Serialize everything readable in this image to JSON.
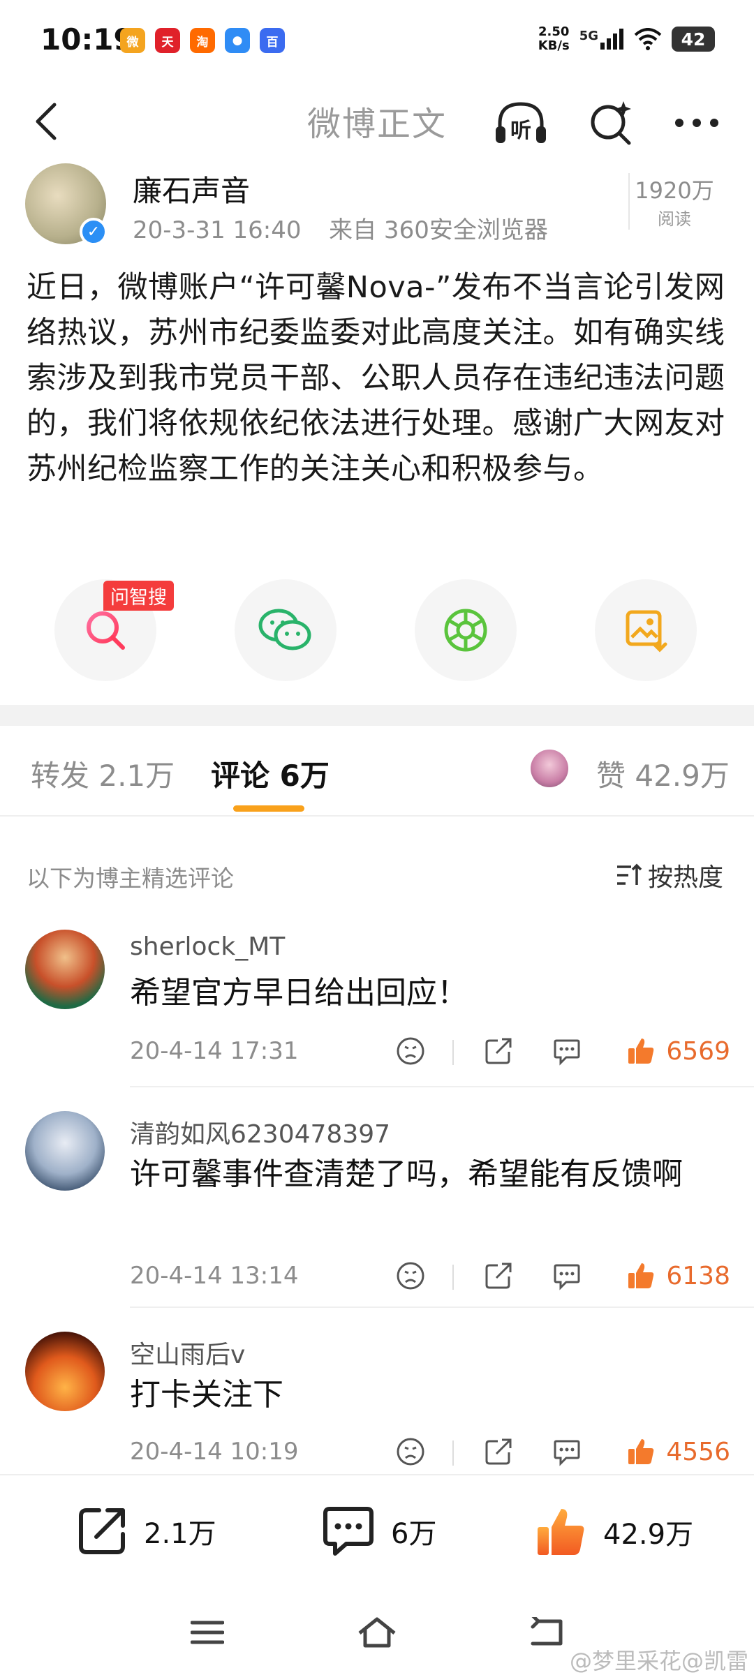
{
  "status_bar": {
    "time": "10:19",
    "apps": [
      {
        "icon": "weibo-icon",
        "color": "#f4a41f",
        "glyph": "微"
      },
      {
        "icon": "tmall-icon",
        "color": "#e0212a",
        "glyph": "天"
      },
      {
        "icon": "taobao-icon",
        "color": "#ff6a00",
        "glyph": "淘"
      },
      {
        "icon": "browser-icon",
        "color": "#2f8cf5",
        "glyph": "●"
      },
      {
        "icon": "baidu-icon",
        "color": "#3b6bf0",
        "glyph": "百"
      }
    ],
    "speed_value": "2.50",
    "speed_unit": "KB/s",
    "network": "5G",
    "battery": "42"
  },
  "title_bar": {
    "title": "微博正文",
    "icons": [
      "back-icon",
      "listen-icon",
      "ai-search-icon",
      "more-icon"
    ],
    "listen_glyph": "听"
  },
  "post": {
    "author": "廉石声音",
    "date": "20-3-31 16:40",
    "source": "来自 360安全浏览器",
    "read_count": "1920万",
    "read_label": "阅读",
    "body": "近日，微博账户“许可馨Nova-”发布不当言论引发网络热议，苏州市纪委监委对此高度关注。如有确实线索涉及到我市党员干部、公职人员存在违纪违法问题的，我们将依规依纪依法进行处理。感谢广大网友对苏州纪检监察工作的关注关心和积极参与。"
  },
  "share": {
    "ask_badge": "问智搜",
    "buttons": [
      "ask-search-icon",
      "wechat-icon",
      "moments-icon",
      "save-image-icon"
    ]
  },
  "tabs": {
    "repost": "转发 2.1万",
    "comments": "评论 6万",
    "likes": "赞 42.9万"
  },
  "filter": {
    "label": "以下为博主精选评论",
    "sort": "按热度"
  },
  "comments": [
    {
      "name": "sherlock_MT",
      "text": "希望官方早日给出回应！",
      "time": "20-4-14 17:31",
      "likes": "6569"
    },
    {
      "name": "清韵如风6230478397",
      "text": "许可馨事件查清楚了吗，希望能有反馈啊",
      "time": "20-4-14 13:14",
      "likes": "6138"
    },
    {
      "name": "空山雨后v",
      "text": "打卡关注下",
      "time": "20-4-14 10:19",
      "likes": "4556"
    }
  ],
  "bottom_bar": {
    "repost": "2.1万",
    "comment": "6万",
    "like": "42.9万"
  },
  "watermark": "@梦里采花@凯雷",
  "colors": {
    "accent_orange": "#f9a11b",
    "like_orange": "#e86a2c",
    "verified_blue": "#2b8ff5",
    "badge_red": "#f43c3c"
  }
}
